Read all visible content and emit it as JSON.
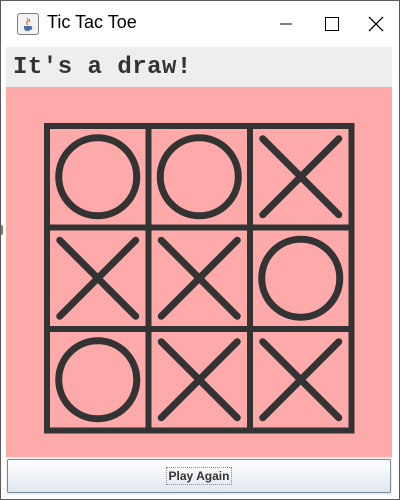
{
  "window": {
    "title": "Tic Tac Toe",
    "icon": "java-cup-icon",
    "controls": [
      "minimize-icon",
      "maximize-icon",
      "close-icon"
    ]
  },
  "status": {
    "text": "It's a draw!"
  },
  "board": {
    "cells": [
      [
        "O",
        "O",
        "X"
      ],
      [
        "X",
        "X",
        "O"
      ],
      [
        "O",
        "X",
        "X"
      ]
    ]
  },
  "actions": {
    "play_again_label": "Play Again"
  },
  "colors": {
    "board_background": "#ffaaaa",
    "grid_and_marks": "#333333",
    "status_background": "#eeeeee",
    "status_text": "#333333"
  }
}
